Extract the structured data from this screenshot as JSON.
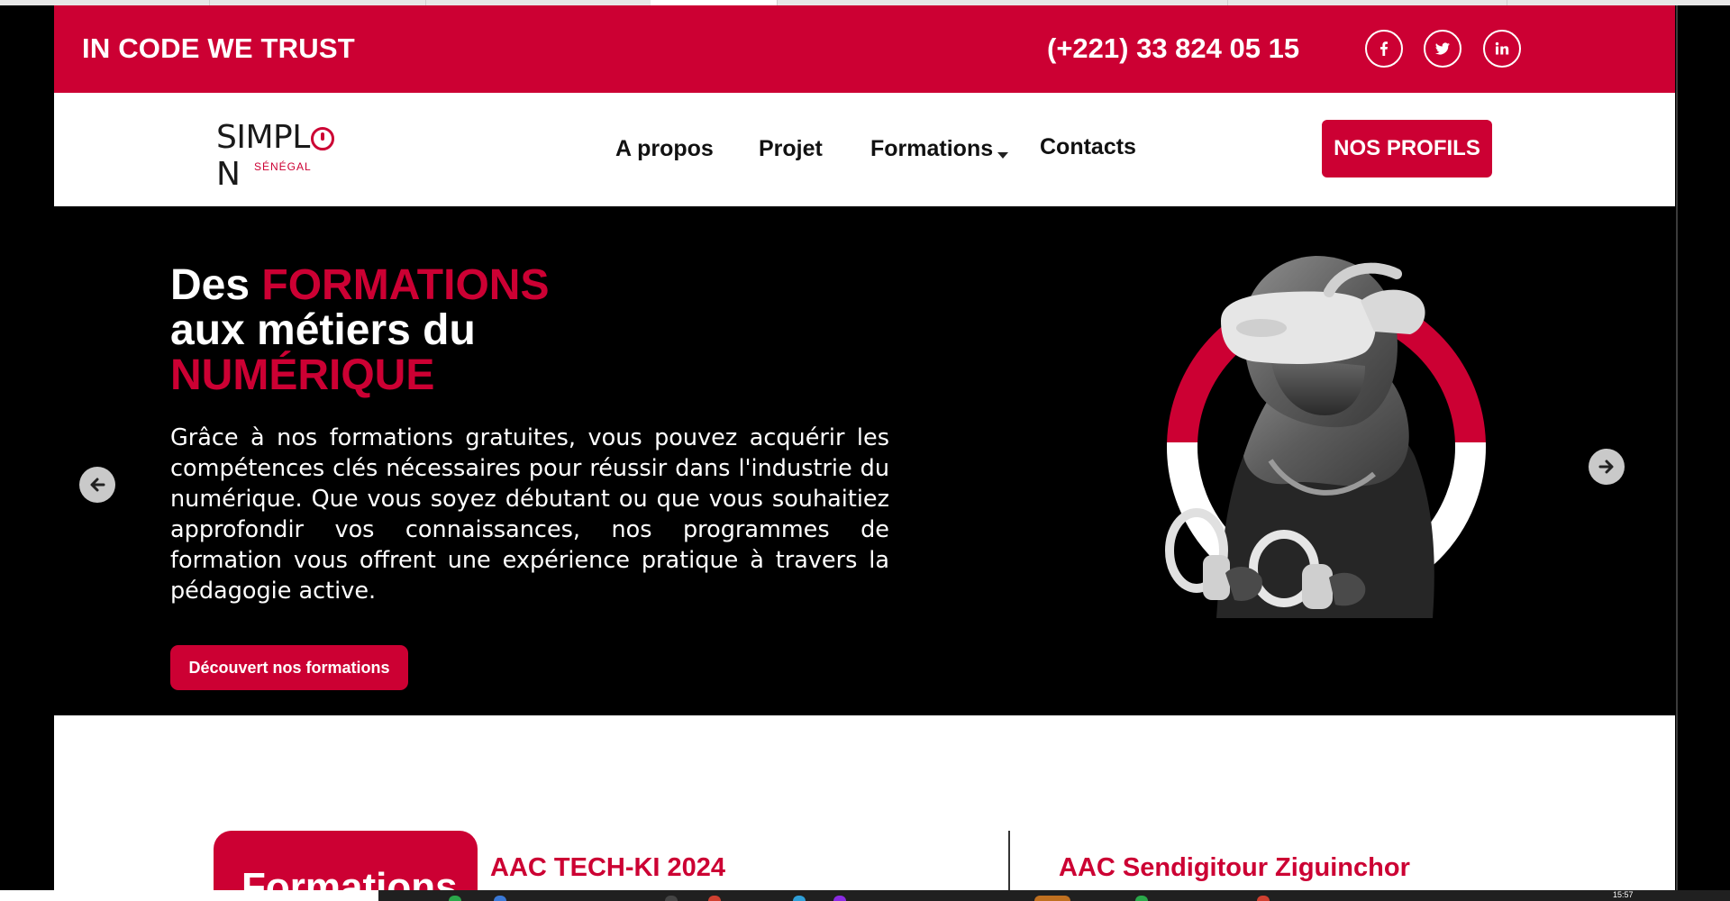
{
  "topbar": {
    "slogan": "IN CODE WE TRUST",
    "phone": "(+221) 33 824 05 15",
    "social": [
      {
        "icon": "facebook-icon"
      },
      {
        "icon": "twitter-icon"
      },
      {
        "icon": "linkedin-icon"
      }
    ],
    "color": "#cc0033"
  },
  "logo": {
    "word_start": "SIMPL",
    "word_end": "N",
    "subtitle": "SÉNÉGAL"
  },
  "nav": {
    "items": [
      "A propos",
      "Projet",
      "Formations",
      "Contacts"
    ],
    "cta": "NOS PROFILS"
  },
  "hero": {
    "title_part1": "Des ",
    "title_highlight1": "FORMATIONS",
    "title_part2": "aux métiers du",
    "title_highlight2": "NUMÉRIQUE",
    "paragraph": "Grâce à nos formations gratuites, vous pouvez acquérir les compétences clés nécessaires pour réussir dans l'industrie du numérique. Que vous soyez débutant ou que vous souhaitiez approfondir vos connaissances, nos programmes de formation vous offrent une expérience pratique à travers la pédagogie active.",
    "button": "Découvert nos formations",
    "prev_icon": "arrow-left-icon",
    "next_icon": "arrow-right-icon"
  },
  "formations": {
    "badge": "Formations",
    "card1_title": "AAC TECH-KI 2024",
    "card2_title": "AAC Sendigitour Ziguinchor"
  },
  "taskbar": {
    "clock": "15:57"
  }
}
